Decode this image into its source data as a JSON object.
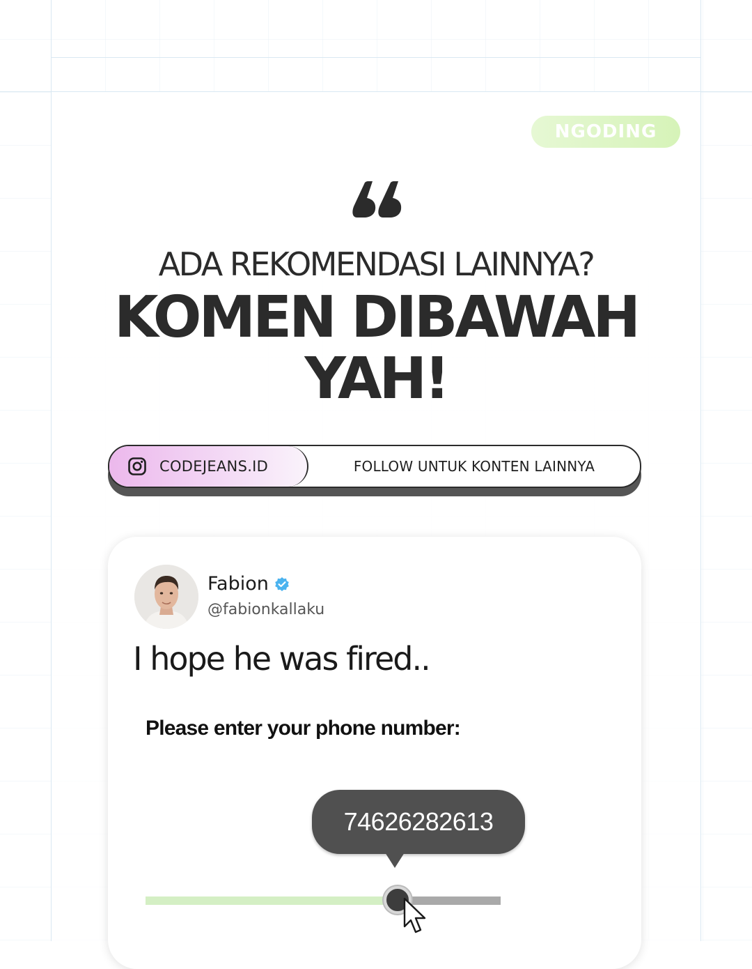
{
  "tag": {
    "label": "NGODING"
  },
  "quote": {
    "icon": "quote-icon"
  },
  "subtitle": "ADA REKOMENDASI LAINNYA?",
  "headline": {
    "line1": "KOMEN DIBAWAH",
    "line2": "YAH!"
  },
  "social": {
    "icon": "instagram-icon",
    "handle": "CODEJEANS.ID",
    "cta": "FOLLOW UNTUK KONTEN LAINNYA"
  },
  "post": {
    "author_name": "Fabion",
    "verified_icon": "verified-badge-icon",
    "author_handle": "@fabionkallaku",
    "text": "I hope he was fired..",
    "prompt": "Please enter your phone number:",
    "slider_value": "74626282613",
    "slider_fraction": 0.71
  },
  "colors": {
    "tag_bg": "#d6f3b8",
    "dark": "#2b2b2b",
    "pill_gradient_start": "#ecb8ec",
    "slider_fill": "#d4efc4",
    "slider_track": "#a9a9a9",
    "tooltip_bg": "#505050"
  }
}
